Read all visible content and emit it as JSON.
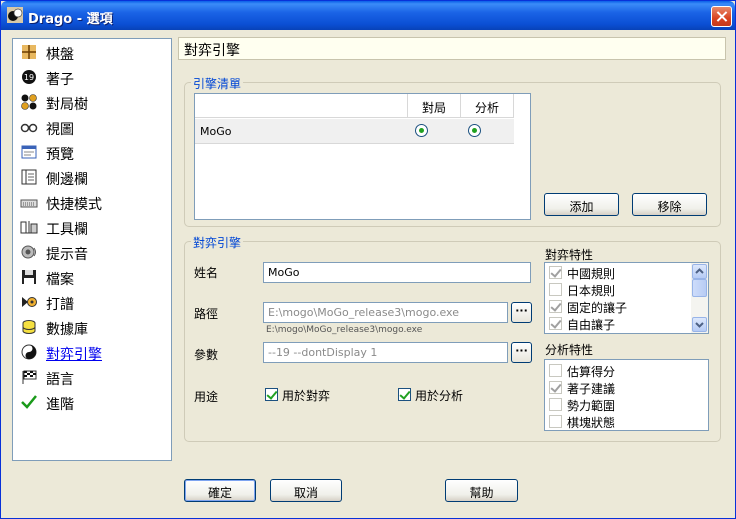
{
  "window": {
    "title": "Drago - 選項"
  },
  "nav": {
    "items": [
      {
        "label": "棋盤",
        "icon": "board-icon"
      },
      {
        "label": "著子",
        "icon": "stone-icon"
      },
      {
        "label": "對局樹",
        "icon": "game-tree-icon"
      },
      {
        "label": "視圖",
        "icon": "view-icon"
      },
      {
        "label": "預覽",
        "icon": "preview-icon"
      },
      {
        "label": "側邊欄",
        "icon": "sidebar-icon"
      },
      {
        "label": "快捷模式",
        "icon": "keyboard-icon"
      },
      {
        "label": "工具欄",
        "icon": "toolbar-icon"
      },
      {
        "label": "提示音",
        "icon": "sound-icon"
      },
      {
        "label": "檔案",
        "icon": "floppy-icon"
      },
      {
        "label": "打譜",
        "icon": "replay-icon"
      },
      {
        "label": "數據庫",
        "icon": "database-icon"
      },
      {
        "label": "對弈引擎",
        "icon": "engine-icon"
      },
      {
        "label": "語言",
        "icon": "language-flag-icon"
      },
      {
        "label": "進階",
        "icon": "checkmark-icon"
      }
    ],
    "selected": "對弈引擎"
  },
  "header": {
    "title": "對弈引擎"
  },
  "engine_list": {
    "group_title": "引擎清單",
    "columns": [
      "",
      "對局",
      "分析"
    ],
    "rows": [
      {
        "name": "MoGo",
        "game": true,
        "analysis": true
      }
    ],
    "add_label": "添加",
    "remove_label": "移除"
  },
  "engine": {
    "group_title": "對弈引擎",
    "name_label": "姓名",
    "name_value": "MoGo",
    "path_label": "路徑",
    "path_value": "E:\\mogo\\MoGo_release3\\mogo.exe",
    "path_hint": "E:\\mogo\\MoGo_release3\\mogo.exe",
    "params_label": "參數",
    "params_value": "--19  --dontDisplay 1",
    "browse_label": "···",
    "usage_label": "用途",
    "use_game_label": "用於對弈",
    "use_game_checked": true,
    "use_analysis_label": "用於分析",
    "use_analysis_checked": true
  },
  "game_features": {
    "title": "對弈特性",
    "items": [
      {
        "label": "中國規則",
        "checked": true
      },
      {
        "label": "日本規則",
        "checked": false
      },
      {
        "label": "固定的讓子",
        "checked": true
      },
      {
        "label": "自由讓子",
        "checked": true
      }
    ]
  },
  "analysis_features": {
    "title": "分析特性",
    "items": [
      {
        "label": "估算得分",
        "checked": false
      },
      {
        "label": "著子建議",
        "checked": true
      },
      {
        "label": "勢力範圍",
        "checked": false
      },
      {
        "label": "棋塊狀態",
        "checked": false
      }
    ]
  },
  "footer": {
    "ok_label": "確定",
    "cancel_label": "取消",
    "help_label": "幫助"
  }
}
